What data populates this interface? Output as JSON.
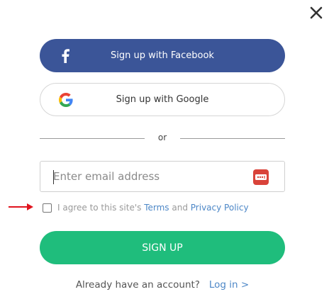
{
  "modal": {
    "close_icon": "close-icon",
    "facebook_button": {
      "label": "Sign up with Facebook",
      "icon": "facebook-icon",
      "color": "#3b5598"
    },
    "google_button": {
      "label": "Sign up with Google",
      "icon": "google-icon"
    },
    "divider_text": "or",
    "email_field": {
      "placeholder": "Enter email address",
      "value": "",
      "icon": "password-manager-icon"
    },
    "agree": {
      "prefix": "I agree to this site's",
      "terms_link": "Terms",
      "and": "and",
      "privacy_link": "Privacy Policy",
      "checked": false
    },
    "signup_button": {
      "label": "SIGN UP",
      "color": "#1fbd7c"
    },
    "login": {
      "prompt": "Already have an account?",
      "link": "Log in >"
    },
    "accent_link_color": "#4d87c7",
    "annotation_arrow_color": "#e0141e"
  }
}
